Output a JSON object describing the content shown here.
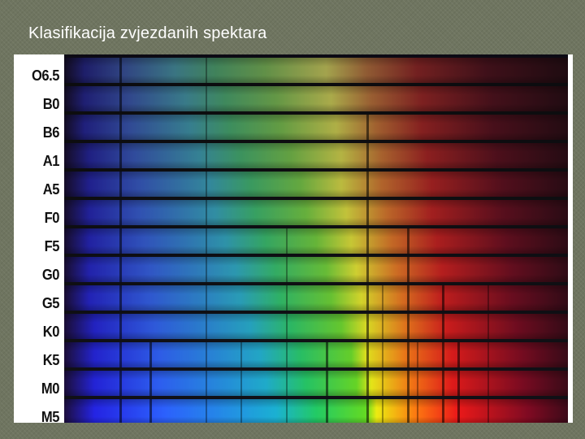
{
  "slide": {
    "title": "Klasifikacija zvjezdanih spektara"
  },
  "spectral_classes": [
    "O6.5",
    "B0",
    "B6",
    "A1",
    "A5",
    "F0",
    "F5",
    "G0",
    "G5",
    "K0",
    "K5",
    "M0",
    "M5"
  ]
}
